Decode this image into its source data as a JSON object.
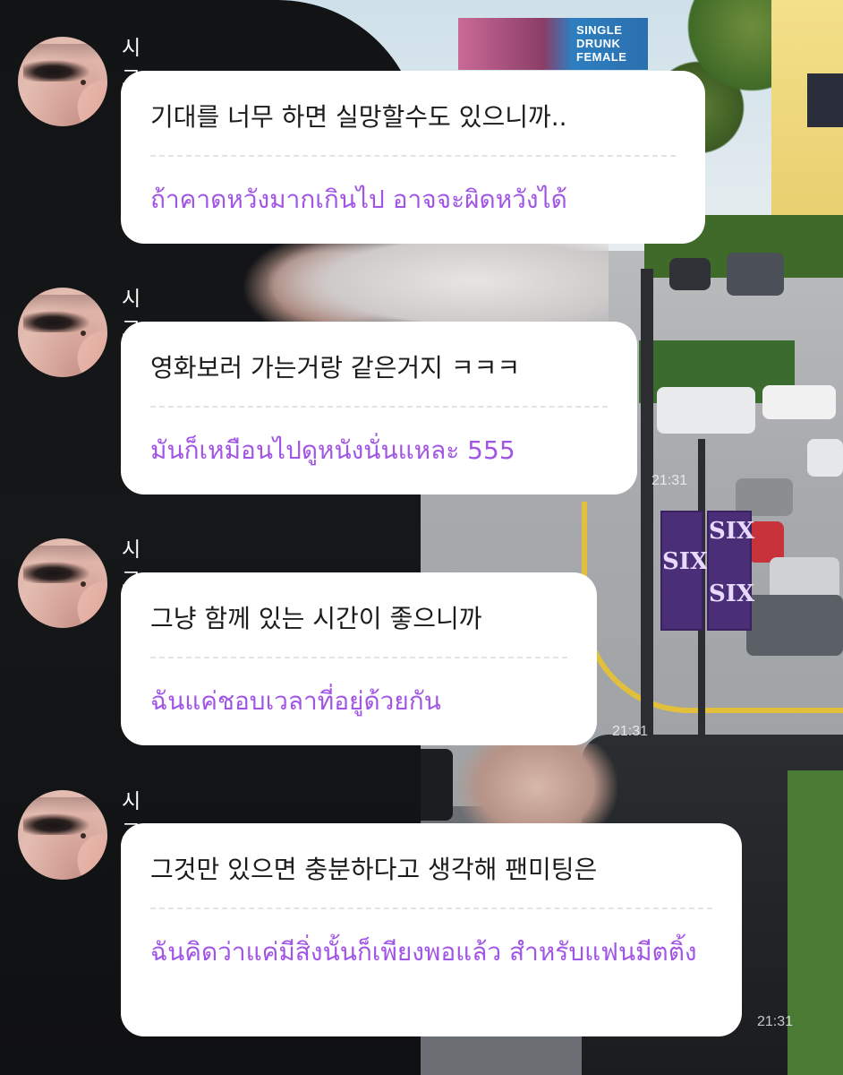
{
  "messages": [
    {
      "sender": "시고르자브",
      "korean": "기대를 너무 하면 실망할수도 있으니까..",
      "thai": "ถ้าคาดหวังมากเกินไป อาจจะผิดหวังได้"
    },
    {
      "sender": "시고르자브",
      "korean": "영화보러 가는거랑 같은거지 ㅋㅋㅋ",
      "thai": "มันก็เหมือนไปดูหนังนั่นแหละ 555"
    },
    {
      "sender": "시고르자브",
      "korean": "그냥 함께 있는 시간이 좋으니까",
      "thai": "ฉันแค่ชอบเวลาที่อยู่ด้วยกัน"
    },
    {
      "sender": "시고르자브",
      "korean": "그것만 있으면 충분하다고 생각해 팬미팅은",
      "thai": "ฉันคิดว่าแค่มีสิ่งนั้นก็เพียงพอแล้ว สำหรับแฟนมีตติ้ง"
    }
  ],
  "timestamps": [
    "21:31",
    "21:31",
    "21:31"
  ],
  "background": {
    "billboard_text": "SINGLE DRUNK FEMALE",
    "banner_text": "SIX"
  },
  "colors": {
    "bubble": "#ffffff",
    "korean_text": "#1b1b1b",
    "thai_text": "#a155e6",
    "sender_name": "#ffffff"
  }
}
